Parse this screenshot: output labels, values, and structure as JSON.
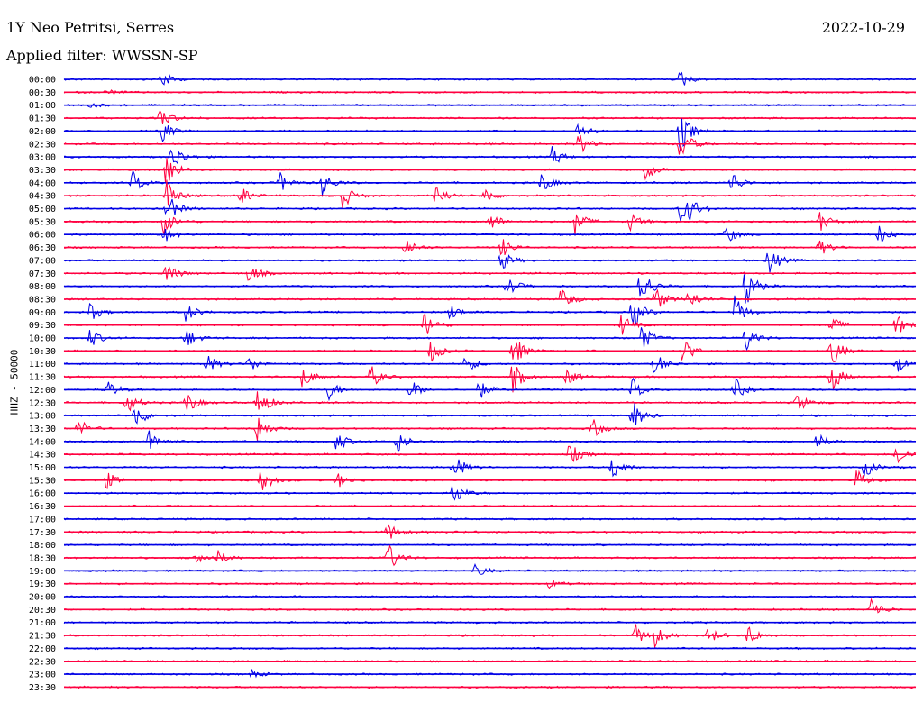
{
  "header": {
    "station": "1Y Neo Petritsi, Serres",
    "filter": "Applied filter: WWSSN-SP",
    "date": "2022-10-29"
  },
  "colors": {
    "blue": "#0000e6",
    "red": "#ff0040"
  },
  "chart_data": {
    "type": "line",
    "ylabel": "HHZ - 50000",
    "rows": [
      "00:00",
      "00:30",
      "01:00",
      "01:30",
      "02:00",
      "02:30",
      "03:00",
      "03:30",
      "04:00",
      "04:30",
      "05:00",
      "05:30",
      "06:00",
      "06:30",
      "07:00",
      "07:30",
      "08:00",
      "08:30",
      "09:00",
      "09:30",
      "10:00",
      "10:30",
      "11:00",
      "11:30",
      "12:00",
      "12:30",
      "13:00",
      "13:30",
      "14:00",
      "14:30",
      "15:00",
      "15:30",
      "16:00",
      "16:30",
      "17:00",
      "17:30",
      "18:00",
      "18:30",
      "19:00",
      "19:30",
      "20:00",
      "20:30",
      "21:00",
      "21:30",
      "22:00",
      "22:30",
      "23:00",
      "23:30"
    ],
    "row_colors": [
      "blue",
      "red"
    ],
    "x_units": "minutes within 30-min row",
    "xlim": [
      0,
      30
    ],
    "events": [
      {
        "row": 0,
        "minute": 3.4,
        "amplitude": 12
      },
      {
        "row": 0,
        "minute": 21.7,
        "amplitude": 11
      },
      {
        "row": 1,
        "minute": 1.5,
        "amplitude": 4
      },
      {
        "row": 2,
        "minute": 0.9,
        "amplitude": 3
      },
      {
        "row": 3,
        "minute": 3.4,
        "amplitude": 14
      },
      {
        "row": 4,
        "minute": 3.4,
        "amplitude": 16
      },
      {
        "row": 4,
        "minute": 18.1,
        "amplitude": 10
      },
      {
        "row": 4,
        "minute": 21.7,
        "amplitude": 26
      },
      {
        "row": 5,
        "minute": 18.1,
        "amplitude": 14
      },
      {
        "row": 5,
        "minute": 21.7,
        "amplitude": 22
      },
      {
        "row": 6,
        "minute": 3.8,
        "amplitude": 18
      },
      {
        "row": 6,
        "minute": 17.2,
        "amplitude": 12
      },
      {
        "row": 7,
        "minute": 3.6,
        "amplitude": 22
      },
      {
        "row": 7,
        "minute": 20.5,
        "amplitude": 14
      },
      {
        "row": 8,
        "minute": 2.4,
        "amplitude": 14
      },
      {
        "row": 8,
        "minute": 7.6,
        "amplitude": 12
      },
      {
        "row": 8,
        "minute": 9.1,
        "amplitude": 14
      },
      {
        "row": 8,
        "minute": 16.8,
        "amplitude": 12
      },
      {
        "row": 8,
        "minute": 23.5,
        "amplitude": 14
      },
      {
        "row": 9,
        "minute": 3.6,
        "amplitude": 20
      },
      {
        "row": 9,
        "minute": 6.2,
        "amplitude": 12
      },
      {
        "row": 9,
        "minute": 9.8,
        "amplitude": 16
      },
      {
        "row": 9,
        "minute": 13.1,
        "amplitude": 14
      },
      {
        "row": 9,
        "minute": 14.8,
        "amplitude": 10
      },
      {
        "row": 10,
        "minute": 3.6,
        "amplitude": 20
      },
      {
        "row": 10,
        "minute": 21.7,
        "amplitude": 14
      },
      {
        "row": 10,
        "minute": 22.0,
        "amplitude": 12
      },
      {
        "row": 11,
        "minute": 3.5,
        "amplitude": 16
      },
      {
        "row": 11,
        "minute": 15.0,
        "amplitude": 12
      },
      {
        "row": 11,
        "minute": 18.0,
        "amplitude": 16
      },
      {
        "row": 11,
        "minute": 19.9,
        "amplitude": 12
      },
      {
        "row": 11,
        "minute": 26.6,
        "amplitude": 12
      },
      {
        "row": 12,
        "minute": 3.5,
        "amplitude": 10
      },
      {
        "row": 12,
        "minute": 23.3,
        "amplitude": 12
      },
      {
        "row": 12,
        "minute": 28.7,
        "amplitude": 12
      },
      {
        "row": 13,
        "minute": 12.0,
        "amplitude": 14
      },
      {
        "row": 13,
        "minute": 15.4,
        "amplitude": 12
      },
      {
        "row": 13,
        "minute": 26.6,
        "amplitude": 10
      },
      {
        "row": 14,
        "minute": 15.4,
        "amplitude": 12
      },
      {
        "row": 14,
        "minute": 24.8,
        "amplitude": 18
      },
      {
        "row": 15,
        "minute": 3.6,
        "amplitude": 14
      },
      {
        "row": 15,
        "minute": 6.5,
        "amplitude": 12
      },
      {
        "row": 16,
        "minute": 15.6,
        "amplitude": 14
      },
      {
        "row": 16,
        "minute": 20.3,
        "amplitude": 26
      },
      {
        "row": 16,
        "minute": 24.0,
        "amplitude": 26
      },
      {
        "row": 17,
        "minute": 17.5,
        "amplitude": 16
      },
      {
        "row": 17,
        "minute": 20.8,
        "amplitude": 16
      },
      {
        "row": 17,
        "minute": 22.0,
        "amplitude": 14
      },
      {
        "row": 18,
        "minute": 0.9,
        "amplitude": 12
      },
      {
        "row": 18,
        "minute": 4.3,
        "amplitude": 12
      },
      {
        "row": 18,
        "minute": 13.6,
        "amplitude": 10
      },
      {
        "row": 18,
        "minute": 20.0,
        "amplitude": 22
      },
      {
        "row": 18,
        "minute": 23.6,
        "amplitude": 20
      },
      {
        "row": 19,
        "minute": 12.7,
        "amplitude": 18
      },
      {
        "row": 19,
        "minute": 19.6,
        "amplitude": 14
      },
      {
        "row": 19,
        "minute": 27.0,
        "amplitude": 12
      },
      {
        "row": 19,
        "minute": 29.3,
        "amplitude": 14
      },
      {
        "row": 20,
        "minute": 0.9,
        "amplitude": 12
      },
      {
        "row": 20,
        "minute": 4.3,
        "amplitude": 12
      },
      {
        "row": 20,
        "minute": 20.3,
        "amplitude": 18
      },
      {
        "row": 20,
        "minute": 24.0,
        "amplitude": 16
      },
      {
        "row": 21,
        "minute": 12.9,
        "amplitude": 14
      },
      {
        "row": 21,
        "minute": 15.8,
        "amplitude": 22
      },
      {
        "row": 21,
        "minute": 21.8,
        "amplitude": 16
      },
      {
        "row": 21,
        "minute": 27.0,
        "amplitude": 22
      },
      {
        "row": 22,
        "minute": 5.0,
        "amplitude": 12
      },
      {
        "row": 22,
        "minute": 6.5,
        "amplitude": 10
      },
      {
        "row": 22,
        "minute": 14.1,
        "amplitude": 12
      },
      {
        "row": 22,
        "minute": 20.8,
        "amplitude": 14
      },
      {
        "row": 22,
        "minute": 29.3,
        "amplitude": 12
      },
      {
        "row": 23,
        "minute": 8.4,
        "amplitude": 14
      },
      {
        "row": 23,
        "minute": 10.8,
        "amplitude": 14
      },
      {
        "row": 23,
        "minute": 15.8,
        "amplitude": 18
      },
      {
        "row": 23,
        "minute": 17.7,
        "amplitude": 12
      },
      {
        "row": 23,
        "minute": 27.0,
        "amplitude": 20
      },
      {
        "row": 24,
        "minute": 1.5,
        "amplitude": 12
      },
      {
        "row": 24,
        "minute": 9.3,
        "amplitude": 12
      },
      {
        "row": 24,
        "minute": 12.2,
        "amplitude": 12
      },
      {
        "row": 24,
        "minute": 14.6,
        "amplitude": 12
      },
      {
        "row": 24,
        "minute": 20.0,
        "amplitude": 14
      },
      {
        "row": 24,
        "minute": 23.6,
        "amplitude": 14
      },
      {
        "row": 25,
        "minute": 2.2,
        "amplitude": 14
      },
      {
        "row": 25,
        "minute": 4.3,
        "amplitude": 14
      },
      {
        "row": 25,
        "minute": 6.8,
        "amplitude": 22
      },
      {
        "row": 25,
        "minute": 25.8,
        "amplitude": 12
      },
      {
        "row": 26,
        "minute": 2.5,
        "amplitude": 16
      },
      {
        "row": 26,
        "minute": 20.0,
        "amplitude": 20
      },
      {
        "row": 27,
        "minute": 0.5,
        "amplitude": 12
      },
      {
        "row": 27,
        "minute": 6.8,
        "amplitude": 18
      },
      {
        "row": 27,
        "minute": 18.6,
        "amplitude": 12
      },
      {
        "row": 28,
        "minute": 3.0,
        "amplitude": 14
      },
      {
        "row": 28,
        "minute": 9.6,
        "amplitude": 12
      },
      {
        "row": 28,
        "minute": 11.7,
        "amplitude": 14
      },
      {
        "row": 28,
        "minute": 26.5,
        "amplitude": 10
      },
      {
        "row": 29,
        "minute": 17.8,
        "amplitude": 14
      },
      {
        "row": 29,
        "minute": 29.3,
        "amplitude": 16
      },
      {
        "row": 30,
        "minute": 13.7,
        "amplitude": 18
      },
      {
        "row": 30,
        "minute": 19.3,
        "amplitude": 16
      },
      {
        "row": 30,
        "minute": 28.2,
        "amplitude": 12
      },
      {
        "row": 31,
        "minute": 1.5,
        "amplitude": 10
      },
      {
        "row": 31,
        "minute": 6.9,
        "amplitude": 18
      },
      {
        "row": 31,
        "minute": 9.6,
        "amplitude": 10
      },
      {
        "row": 31,
        "minute": 27.9,
        "amplitude": 12
      },
      {
        "row": 32,
        "minute": 13.7,
        "amplitude": 16
      },
      {
        "row": 35,
        "minute": 11.4,
        "amplitude": 12
      },
      {
        "row": 37,
        "minute": 4.6,
        "amplitude": 10
      },
      {
        "row": 37,
        "minute": 5.4,
        "amplitude": 8
      },
      {
        "row": 37,
        "minute": 11.4,
        "amplitude": 18
      },
      {
        "row": 38,
        "minute": 14.5,
        "amplitude": 8
      },
      {
        "row": 39,
        "minute": 17.1,
        "amplitude": 6
      },
      {
        "row": 41,
        "minute": 28.4,
        "amplitude": 16
      },
      {
        "row": 43,
        "minute": 20.1,
        "amplitude": 14
      },
      {
        "row": 43,
        "minute": 20.8,
        "amplitude": 12
      },
      {
        "row": 43,
        "minute": 22.7,
        "amplitude": 10
      },
      {
        "row": 43,
        "minute": 24.1,
        "amplitude": 12
      },
      {
        "row": 46,
        "minute": 6.6,
        "amplitude": 5
      }
    ]
  }
}
